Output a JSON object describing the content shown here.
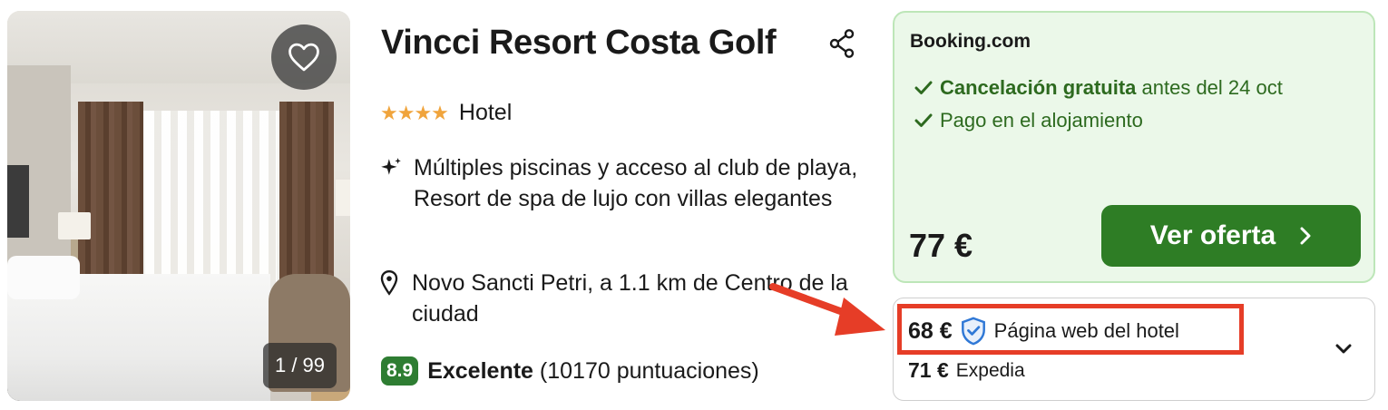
{
  "hotel": {
    "name": "Vincci Resort Costa Golf",
    "stars": "★★★★",
    "type": "Hotel",
    "feature": "Múltiples piscinas y acceso al club de playa, Resort de spa de lujo con villas elegantes",
    "location": "Novo Sancti Petri, a 1.1 km de Centro de la ciudad",
    "rating": {
      "score": "8.9",
      "label": "Excelente",
      "count": "(10170 puntuaciones)"
    }
  },
  "photo": {
    "counter": "1 / 99"
  },
  "offer": {
    "provider": "Booking.com",
    "perk1_bold": "Cancelación gratuita",
    "perk1_rest": "antes del 24 oct",
    "perk2": "Pago en el alojamiento",
    "price": "77 €",
    "cta_label": "Ver oferta"
  },
  "other_offers": [
    {
      "price": "68 €",
      "source": "Página web del hotel"
    },
    {
      "price": "71 €",
      "source": "Expedia"
    }
  ],
  "colors": {
    "accent_green": "#2e7d25",
    "offer_bg": "#ebf8e9",
    "highlight": "#e63d27",
    "stars": "#f0a43c"
  }
}
